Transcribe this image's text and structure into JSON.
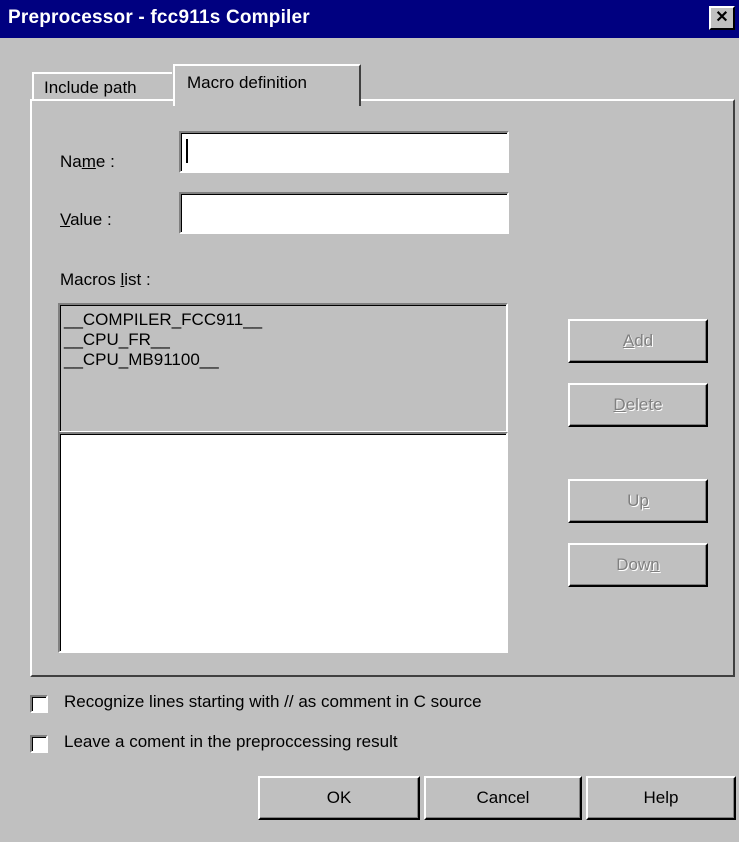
{
  "window": {
    "title": "Preprocessor - fcc911s Compiler",
    "close_glyph": "✕"
  },
  "tabs": [
    {
      "label": "Include path",
      "active": false
    },
    {
      "label": "Macro definition",
      "active": true
    }
  ],
  "form": {
    "name_label_pre": "Na",
    "name_label_u": "m",
    "name_label_post": "e :",
    "name_value": "",
    "value_label_u": "V",
    "value_label_post": "alue :",
    "value_value": "",
    "macros_label_pre": "Macros ",
    "macros_label_u": "l",
    "macros_label_post": "ist :"
  },
  "macros": [
    "__COMPILER_FCC911__",
    "__CPU_FR__",
    "__CPU_MB91100__"
  ],
  "buttons": {
    "add_u": "A",
    "add_rest": "dd",
    "delete_u": "D",
    "delete_rest": "elete",
    "up_pre": "U",
    "up_u": "p",
    "down_pre": "Dow",
    "down_u": "n"
  },
  "checkboxes": [
    {
      "label": "Recognize lines starting with // as comment in C source",
      "checked": false
    },
    {
      "label": "Leave a coment in the preproccessing result",
      "checked": false
    }
  ],
  "footer": {
    "ok": "OK",
    "cancel": "Cancel",
    "help": "Help"
  },
  "colors": {
    "titlebar": "#000080",
    "face": "#c0c0c0",
    "disabled_text": "#808080"
  }
}
